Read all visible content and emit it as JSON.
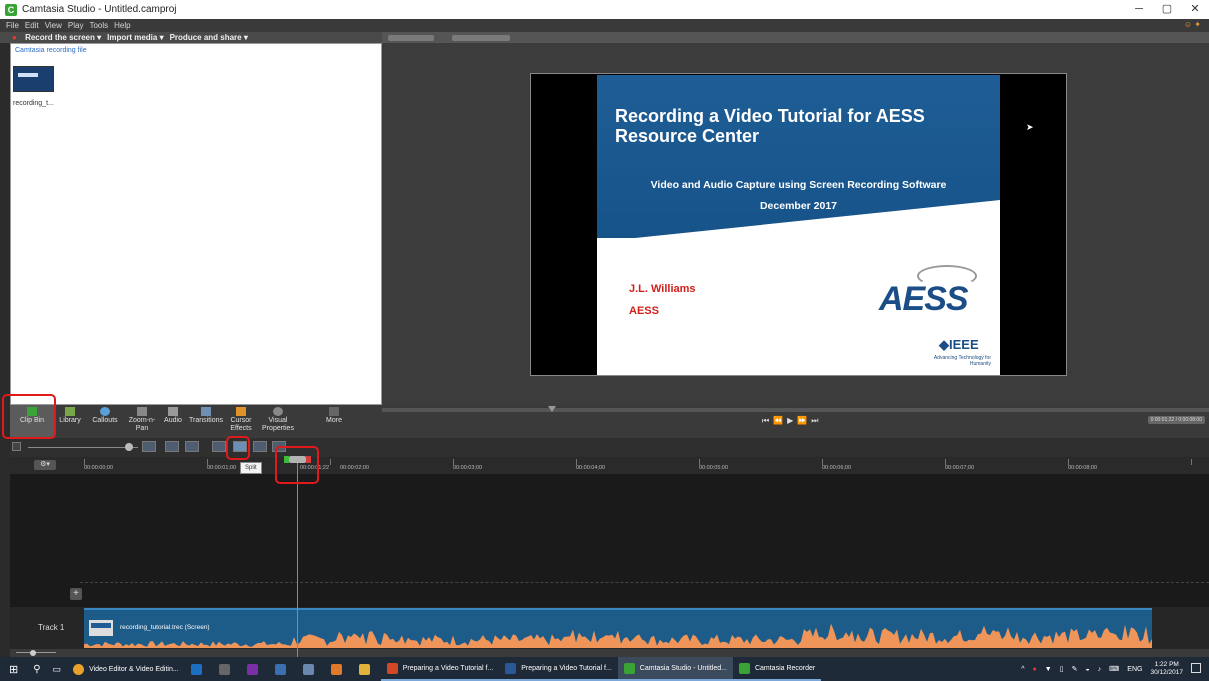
{
  "window": {
    "title": "Camtasia Studio - Untitled.camproj",
    "controls": [
      "─",
      "▢",
      "✕"
    ]
  },
  "menu": [
    "File",
    "Edit",
    "View",
    "Play",
    "Tools",
    "Help"
  ],
  "tasks": {
    "record": "Record the screen ▾",
    "import": "Import media ▾",
    "produce": "Produce and share ▾"
  },
  "clip_bin": {
    "header": "Camtasia recording file",
    "items": [
      {
        "label": "recording_t..."
      }
    ]
  },
  "slide": {
    "title": "Recording a Video Tutorial for AESS Resource Center",
    "subtitle": "Video and Audio Capture using Screen Recording Software",
    "date": "December 2017",
    "author": "J.L. Williams",
    "org": "AESS",
    "logo_text": "AESS",
    "ieee": "◆IEEE",
    "ieee_tagline": "Advancing Technology for Humanity"
  },
  "tools": [
    {
      "label": "Clip Bin",
      "icon": "clip-bin-icon",
      "active": true
    },
    {
      "label": "Library",
      "icon": "library-icon"
    },
    {
      "label": "Callouts",
      "icon": "callouts-icon"
    },
    {
      "label": "Zoom-n-Pan",
      "icon": "zoom-pan-icon"
    },
    {
      "label": "Audio",
      "icon": "audio-icon"
    },
    {
      "label": "Transitions",
      "icon": "transitions-icon"
    },
    {
      "label": "Cursor Effects",
      "icon": "cursor-effects-icon"
    },
    {
      "label": "Visual Properties",
      "icon": "visual-properties-icon"
    },
    {
      "label": "More",
      "icon": "more-icon"
    }
  ],
  "playback": {
    "controls": [
      "⏮",
      "⏪",
      "▶",
      "⏩",
      "⏭"
    ]
  },
  "timeline": {
    "tooltip": "Split",
    "gear_label": "⚙▾",
    "ruler": [
      "00:00:00;00",
      "00:00:01;00",
      "00:00:01;22",
      "00:00:02;00",
      "00:00:03;00",
      "00:00:04;00",
      "00:00:05;00",
      "00:00:06;00",
      "00:00:07;00",
      "00:00:08;00"
    ],
    "add_track": "+",
    "track_label": "Track 1",
    "clip_label": "recording_tutorial.trec (Screen)"
  },
  "taskbar": {
    "items": [
      {
        "label": "Video Editor & Video Editin...",
        "color": "#e9a12b"
      },
      {
        "label": "",
        "color": "#1d6fc2"
      },
      {
        "label": "",
        "color": "#666666"
      },
      {
        "label": "",
        "color": "#7b2fa6"
      },
      {
        "label": "",
        "color": "#3a6fb0"
      },
      {
        "label": "",
        "color": "#6a88b0"
      },
      {
        "label": "",
        "color": "#e07a28"
      },
      {
        "label": "",
        "color": "#e2b33a"
      },
      {
        "label": "Preparing a Video Tutorial f...",
        "color": "#d24726"
      },
      {
        "label": "Preparing a Video Tutorial f...",
        "color": "#2b5797"
      },
      {
        "label": "Camtasia Studio - Untitled...",
        "color": "#3aa335"
      },
      {
        "label": "Camtasia Recorder",
        "color": "#3aa335"
      }
    ],
    "lang": "ENG",
    "time": "1:22 PM",
    "date": "30/12/2017"
  },
  "colors": {
    "accent": "#1d5c88",
    "highlight": "#e0191a",
    "audio_wave": "#f0955a"
  }
}
